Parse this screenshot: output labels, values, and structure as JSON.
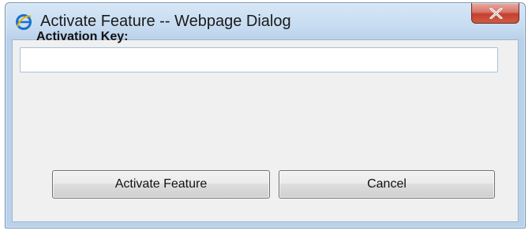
{
  "window": {
    "title": "Activate Feature -- Webpage Dialog",
    "icon": "internet-explorer-icon",
    "close_icon": "close-icon"
  },
  "form": {
    "activation_key_label": "Activation Key:",
    "activation_key_value": ""
  },
  "buttons": {
    "activate_label": "Activate Feature",
    "cancel_label": "Cancel"
  },
  "colors": {
    "titlebar": "#c7dcf1",
    "client_bg": "#f0f0f0",
    "close_button": "#c4402f"
  }
}
